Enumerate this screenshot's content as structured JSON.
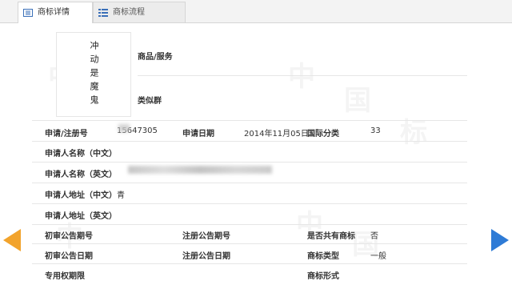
{
  "tabs": [
    {
      "label": "商标详情",
      "icon": "document-icon"
    },
    {
      "label": "商标流程",
      "icon": "list-icon"
    }
  ],
  "watermark_text": "中国商标",
  "mark_image_text": "冲动是魔鬼",
  "fields": {
    "goods_services_label": "商品/服务",
    "similar_group_label": "类似群",
    "reg_no_label": "申请/注册号",
    "reg_no_value": "15647305",
    "apply_date_label": "申请日期",
    "apply_date_value": "2014年11月05日",
    "intl_class_label": "国际分类",
    "intl_class_value": "33",
    "applicant_cn_label": "申请人名称（中文）",
    "applicant_en_label": "申请人名称（英文）",
    "address_cn_label": "申请人地址（中文）",
    "address_cn_prefix": "青",
    "address_en_label": "申请人地址（英文）",
    "prelim_issue_label": "初审公告期号",
    "reg_issue_label": "注册公告期号",
    "shared_label": "是否共有商标",
    "shared_value": "否",
    "prelim_date_label": "初审公告日期",
    "reg_date_label": "注册公告日期",
    "mark_type_label": "商标类型",
    "mark_type_value": "一般",
    "exclusive_period_label": "专用权期限",
    "mark_form_label": "商标形式"
  },
  "colors": {
    "prev_arrow": "#f2a32c",
    "next_arrow": "#2e7bd6",
    "tab_icon": "#3a6fb8"
  }
}
